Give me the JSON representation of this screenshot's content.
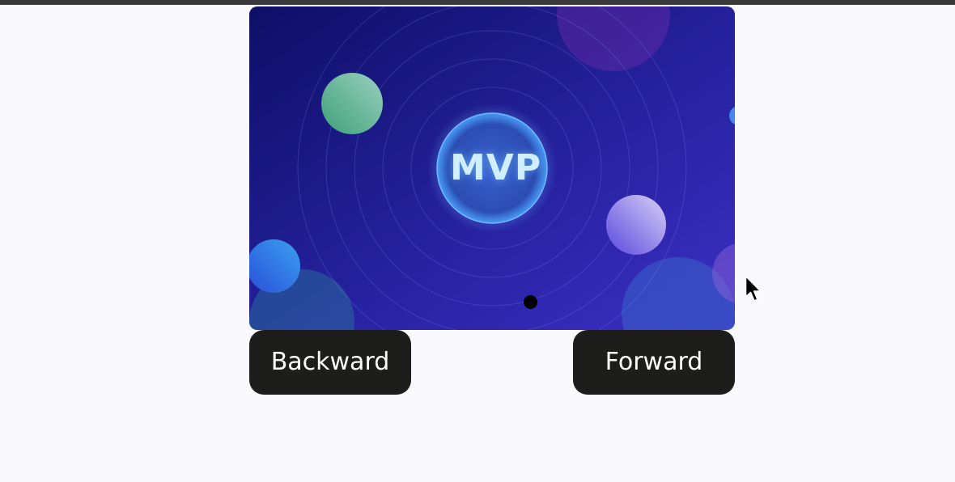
{
  "slide": {
    "badge_text": "MVP",
    "active_index": 1
  },
  "controls": {
    "backward_label": "Backward",
    "forward_label": "Forward"
  },
  "colors": {
    "page_background": "#f8f8fd",
    "button_background": "#1d1d1b",
    "button_text": "#ffffff",
    "slide_gradient_start": "#101070",
    "slide_gradient_end": "#3a2cc0",
    "badge_fill": "#2d4fb5",
    "badge_text": "#cfeeff"
  },
  "icons": {
    "cursor": "mouse-pointer-icon"
  }
}
